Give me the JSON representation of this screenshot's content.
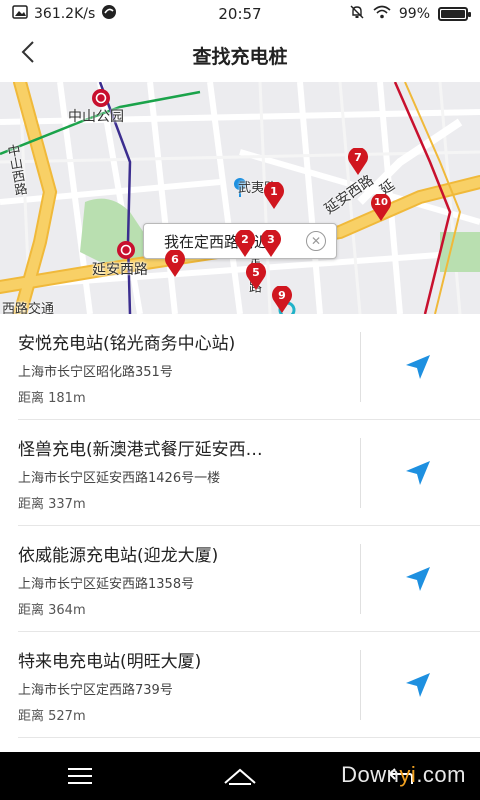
{
  "status_bar": {
    "speed": "361.2K/s",
    "time": "20:57",
    "battery_text": "99%",
    "battery_level": 0.99
  },
  "header": {
    "title": "查找充电桩",
    "back_icon": "chevron-left-icon"
  },
  "map": {
    "location_bubble": "我在定西路附近",
    "labels": [
      "中山公园",
      "中山西路",
      "延安西路",
      "西路交通",
      "武夷路",
      "延安西路",
      "定西路",
      "延"
    ],
    "markers": [
      "1",
      "2",
      "3",
      "5",
      "6",
      "7",
      "9",
      "10"
    ],
    "colors": {
      "road_major": "#f5c84a",
      "pin": "#d0161f",
      "metro_red": "#c8102e",
      "metro_green": "#1aa34a",
      "metro_purple": "#3b2d8f",
      "park": "#b9dfb0"
    }
  },
  "stations": [
    {
      "name": "安悦充电站(铭光商务中心站)",
      "address": "上海市长宁区昭化路351号",
      "distance": "距离 181m"
    },
    {
      "name": "怪兽充电(新澳港式餐厅延安西…",
      "address": "上海市长宁区延安西路1426号一楼",
      "distance": "距离 337m"
    },
    {
      "name": "依威能源充电站(迎龙大厦)",
      "address": "上海市长宁区延安西路1358号",
      "distance": "距离 364m"
    },
    {
      "name": "特来电充电站(明旺大厦)",
      "address": "上海市长宁区定西路739号",
      "distance": "距离 527m"
    }
  ],
  "nav_icon": "navigate-arrow-icon",
  "accent_color": "#1e90e0",
  "watermark": {
    "part1": "Down",
    "part2": "yi",
    "part3": ".com"
  }
}
